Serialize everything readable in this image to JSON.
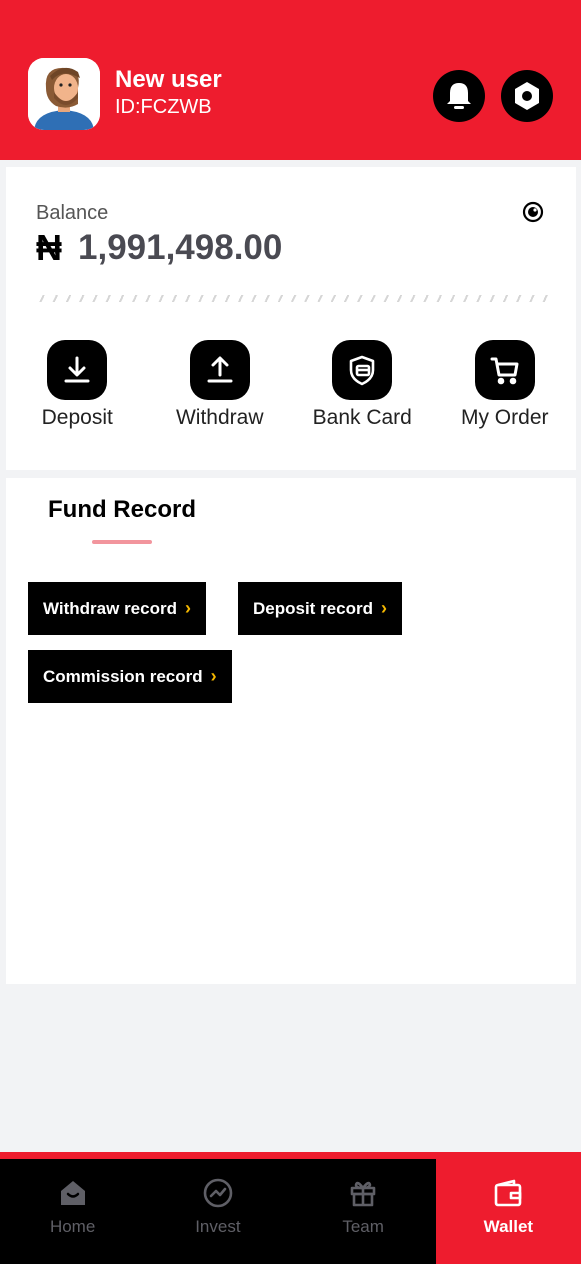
{
  "header": {
    "user_name": "New user",
    "user_id": "ID:FCZWB",
    "accent": "#ee1c2e"
  },
  "balance": {
    "label": "Balance",
    "currency": "₦",
    "amount": "1,991,498.00"
  },
  "actions": [
    {
      "label": "Deposit",
      "icon": "download-icon"
    },
    {
      "label": "Withdraw",
      "icon": "upload-icon"
    },
    {
      "label": "Bank Card",
      "icon": "card-shield-icon"
    },
    {
      "label": "My Order",
      "icon": "cart-icon"
    }
  ],
  "fund": {
    "title": "Fund Record",
    "buttons": [
      {
        "label": "Withdraw record"
      },
      {
        "label": "Deposit record"
      },
      {
        "label": "Commission record"
      }
    ]
  },
  "tabs": [
    {
      "label": "Home",
      "icon": "home-icon"
    },
    {
      "label": "Invest",
      "icon": "chart-icon"
    },
    {
      "label": "Team",
      "icon": "gift-icon"
    },
    {
      "label": "Wallet",
      "icon": "wallet-icon",
      "active": true
    }
  ]
}
